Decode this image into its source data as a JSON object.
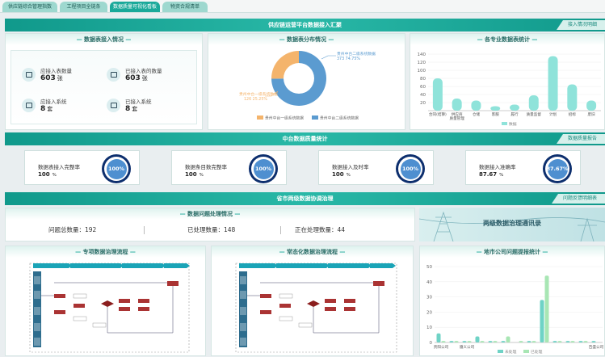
{
  "tabs": [
    "供应链综合管理指数",
    "工程项目全链条",
    "数据质量可视化看板",
    "物资合规清单"
  ],
  "active_tab": 2,
  "bands": {
    "top": {
      "title": "供应链运营平台数据接入汇聚",
      "button": "接入情况明细"
    },
    "mid": {
      "title": "中台数据质量统计",
      "button": "数据质量报告"
    },
    "bottom": {
      "title": "省市两级数据协调治理",
      "button": "问题反馈明细表"
    }
  },
  "access": {
    "title": "数据表接入情况",
    "items": [
      {
        "label": "应接入表数量",
        "value": "603",
        "unit": "张",
        "icon": "table-icon"
      },
      {
        "label": "已接入表的数量",
        "value": "603",
        "unit": "张",
        "icon": "copy-icon"
      },
      {
        "label": "应接入系统",
        "value": "8",
        "unit": "套",
        "icon": "monitor-icon"
      },
      {
        "label": "已接入系统",
        "value": "8",
        "unit": "套",
        "icon": "grid-icon"
      }
    ]
  },
  "distribution": {
    "title": "数据表分布情况",
    "chart_data": {
      "type": "pie",
      "series": [
        {
          "name": "贵州中台二级系统数据",
          "label": "373  74.75%",
          "value": 373,
          "pct": 74.75,
          "color": "#5b9bd0"
        },
        {
          "name": "贵州中台一级系统数据",
          "label": "126  25.25%",
          "value": 126,
          "pct": 25.25,
          "color": "#f4b46c"
        }
      ]
    }
  },
  "category": {
    "title": "各专业数据表统计",
    "chart_data": {
      "type": "bar",
      "categories": [
        "合同(结算)",
        "供应商",
        "仓储",
        "客服",
        "履行",
        "质量监督",
        "计划",
        "招标",
        "废旧"
      ],
      "sublabels": [
        "",
        "质量管理",
        "",
        "",
        "",
        "",
        "",
        "",
        ""
      ],
      "values": [
        80,
        30,
        25,
        11,
        15,
        38,
        135,
        65,
        25
      ],
      "ylim": [
        0,
        140
      ],
      "yticks": [
        20,
        40,
        60,
        80,
        100,
        120,
        140
      ],
      "legend": "数据",
      "color": "#8fe3da"
    }
  },
  "quality": [
    {
      "label": "数据表接入完整率",
      "value": "100",
      "unit": "%",
      "ring": "100%"
    },
    {
      "label": "数据条目数完整率",
      "value": "100",
      "unit": "%",
      "ring": "100%"
    },
    {
      "label": "数据接入及时率",
      "value": "100",
      "unit": "%",
      "ring": "100%"
    },
    {
      "label": "数据接入准确率",
      "value": "87.67",
      "unit": "%",
      "ring": "87.67%"
    }
  ],
  "issues": {
    "title": "数据问题处理情况",
    "total": "问题总数量：192",
    "done": "已处理数量：148",
    "processing": "正在处理数量：44"
  },
  "banner": "两级数据治理通讯录",
  "flow1": {
    "title": "专项数据治理流程"
  },
  "flow2": {
    "title": "常态化数据治理流程"
  },
  "city": {
    "title": "地市公司问题提报统计",
    "chart_data": {
      "type": "bar",
      "categories": [
        "贵阳公司",
        "",
        "遵义公司",
        "",
        "",
        "",
        "",
        "",
        "",
        "",
        "",
        "",
        "百盛公司"
      ],
      "series": [
        {
          "name": "未处理",
          "values": [
            6,
            1,
            1,
            4,
            1,
            1,
            0,
            1,
            28,
            1,
            1,
            1,
            1
          ],
          "color": "#6fd3c6"
        },
        {
          "name": "已处理",
          "values": [
            1,
            1,
            1,
            1,
            1,
            4,
            1,
            1,
            44,
            1,
            1,
            1,
            0
          ],
          "color": "#a8e6b4"
        }
      ],
      "ylim": [
        0,
        50
      ],
      "yticks": [
        0,
        10,
        20,
        30,
        40,
        50
      ],
      "legend": [
        "未处理",
        "已处理"
      ]
    }
  }
}
